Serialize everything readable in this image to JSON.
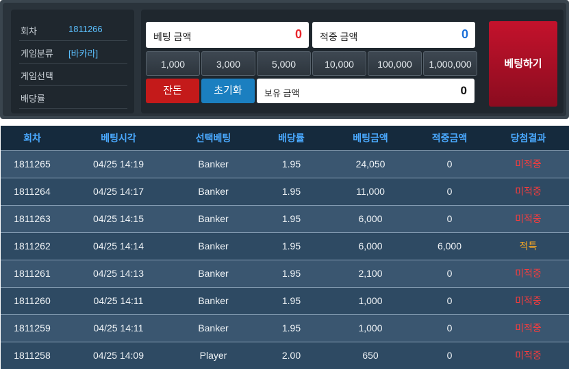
{
  "info": {
    "rows": [
      {
        "label": "회차",
        "value": "1811266"
      },
      {
        "label": "게임분류",
        "value": "[바카라]"
      },
      {
        "label": "게임선택",
        "value": ""
      },
      {
        "label": "배당률",
        "value": ""
      }
    ]
  },
  "bet": {
    "bet_amount_label": "베팅 금액",
    "bet_amount_value": "0",
    "win_amount_label": "적중 금액",
    "win_amount_value": "0",
    "chips": [
      "1,000",
      "3,000",
      "5,000",
      "10,000",
      "100,000",
      "1,000,000"
    ],
    "all_in_label": "잔돈",
    "reset_label": "초기화",
    "balance_label": "보유 금액",
    "balance_value": "0",
    "place_bet_label": "베팅하기"
  },
  "table": {
    "headers": [
      "회차",
      "베팅시각",
      "선택베팅",
      "배당률",
      "베팅금액",
      "적중금액",
      "당첨결과"
    ],
    "rows": [
      {
        "round": "1811265",
        "time": "04/25 14:19",
        "pick": "Banker",
        "odds": "1.95",
        "amount": "24,050",
        "win": "0",
        "result": "미적중"
      },
      {
        "round": "1811264",
        "time": "04/25 14:17",
        "pick": "Banker",
        "odds": "1.95",
        "amount": "11,000",
        "win": "0",
        "result": "미적중"
      },
      {
        "round": "1811263",
        "time": "04/25 14:15",
        "pick": "Banker",
        "odds": "1.95",
        "amount": "6,000",
        "win": "0",
        "result": "미적중"
      },
      {
        "round": "1811262",
        "time": "04/25 14:14",
        "pick": "Banker",
        "odds": "1.95",
        "amount": "6,000",
        "win": "6,000",
        "result": "적특"
      },
      {
        "round": "1811261",
        "time": "04/25 14:13",
        "pick": "Banker",
        "odds": "1.95",
        "amount": "2,100",
        "win": "0",
        "result": "미적중"
      },
      {
        "round": "1811260",
        "time": "04/25 14:11",
        "pick": "Banker",
        "odds": "1.95",
        "amount": "1,000",
        "win": "0",
        "result": "미적중"
      },
      {
        "round": "1811259",
        "time": "04/25 14:11",
        "pick": "Banker",
        "odds": "1.95",
        "amount": "1,000",
        "win": "0",
        "result": "미적중"
      },
      {
        "round": "1811258",
        "time": "04/25 14:09",
        "pick": "Player",
        "odds": "2.00",
        "amount": "650",
        "win": "0",
        "result": "미적중"
      }
    ]
  },
  "colors": {
    "bet_amount": "#e8262c",
    "win_amount": "#1a6fd8",
    "result_lose": "#ff3b3b",
    "result_win": "#f5a623"
  }
}
